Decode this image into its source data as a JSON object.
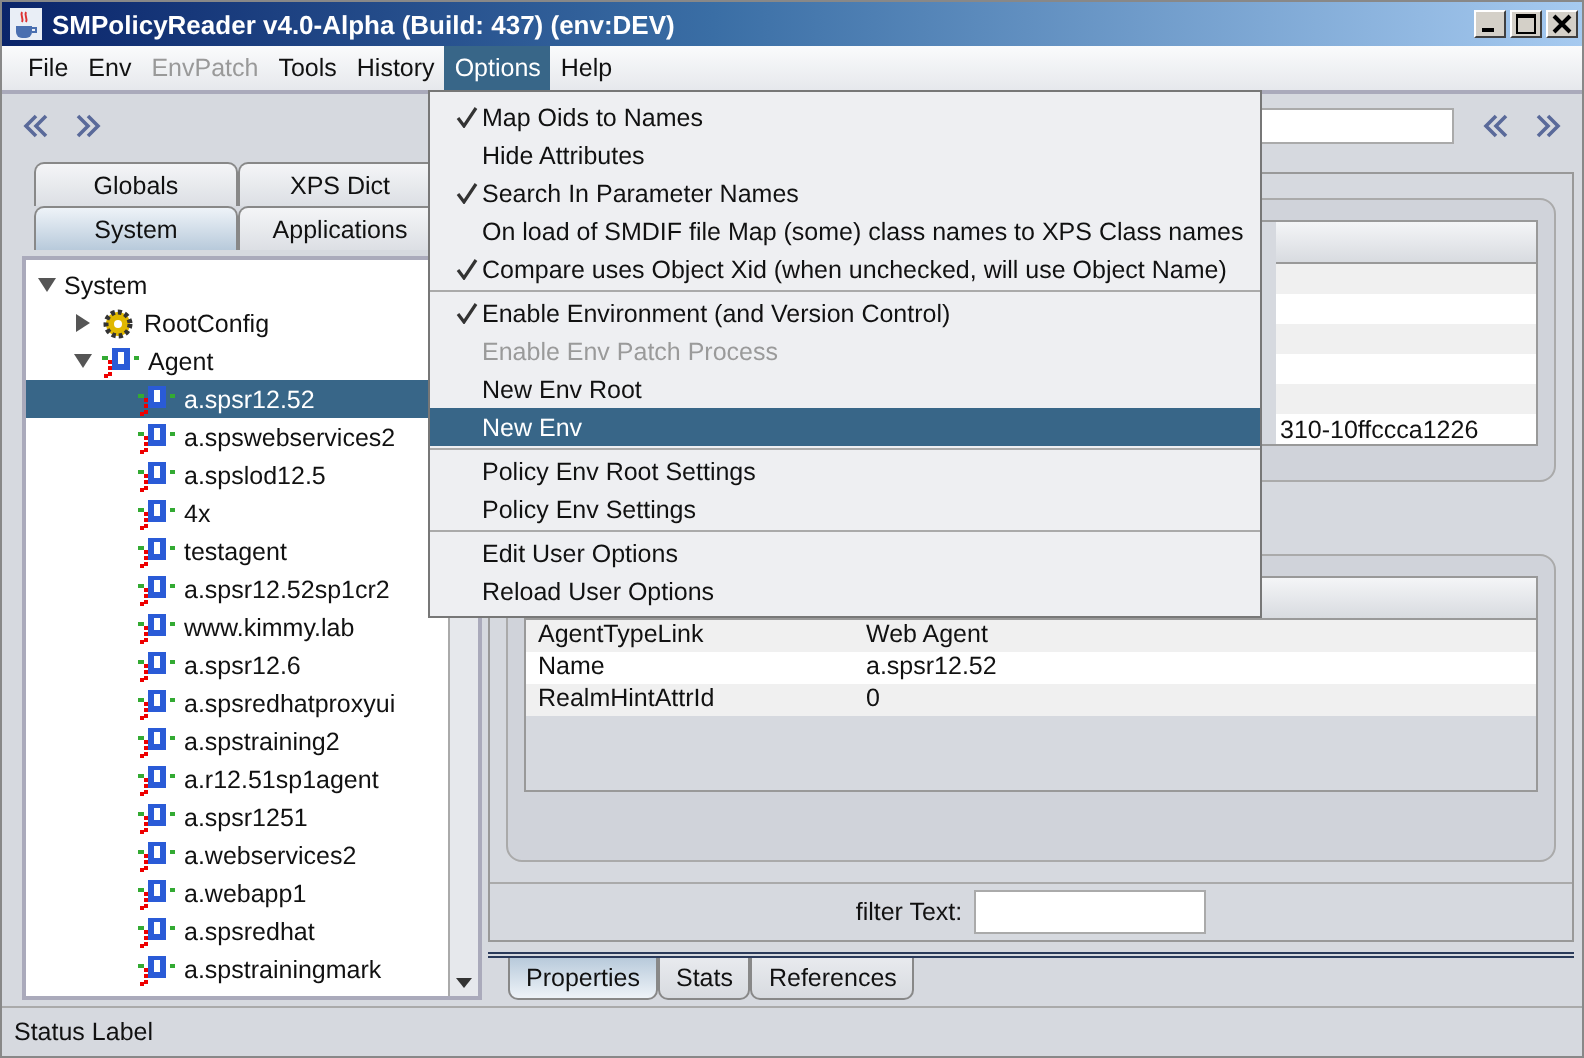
{
  "window": {
    "title": "SMPolicyReader v4.0-Alpha (Build: 437) (env:DEV)"
  },
  "menubar": [
    {
      "label": "File",
      "selected": false,
      "disabled": false
    },
    {
      "label": "Env",
      "selected": false,
      "disabled": false
    },
    {
      "label": "EnvPatch",
      "selected": false,
      "disabled": true
    },
    {
      "label": "Tools",
      "selected": false,
      "disabled": false
    },
    {
      "label": "History",
      "selected": false,
      "disabled": false
    },
    {
      "label": "Options",
      "selected": true,
      "disabled": false
    },
    {
      "label": "Help",
      "selected": false,
      "disabled": false
    }
  ],
  "options_menu": [
    {
      "kind": "item",
      "label": "Map Oids to Names",
      "checked": true,
      "disabled": false,
      "selected": false
    },
    {
      "kind": "item",
      "label": "Hide Attributes",
      "checked": false,
      "disabled": false,
      "selected": false
    },
    {
      "kind": "item",
      "label": "Search In Parameter Names",
      "checked": true,
      "disabled": false,
      "selected": false
    },
    {
      "kind": "item",
      "label": "On load of SMDIF file Map (some) class names to XPS Class names",
      "checked": false,
      "disabled": false,
      "selected": false
    },
    {
      "kind": "item",
      "label": "Compare uses Object Xid (when unchecked, will use Object Name)",
      "checked": true,
      "disabled": false,
      "selected": false
    },
    {
      "kind": "separator"
    },
    {
      "kind": "item",
      "label": "Enable Environment (and Version Control)",
      "checked": true,
      "disabled": false,
      "selected": false
    },
    {
      "kind": "item",
      "label": "Enable Env Patch Process",
      "checked": false,
      "disabled": true,
      "selected": false
    },
    {
      "kind": "item",
      "label": "New Env Root",
      "checked": false,
      "disabled": false,
      "selected": false
    },
    {
      "kind": "item",
      "label": "New Env",
      "checked": false,
      "disabled": false,
      "selected": true
    },
    {
      "kind": "separator"
    },
    {
      "kind": "item",
      "label": "Policy Env Root Settings",
      "checked": false,
      "disabled": false,
      "selected": false
    },
    {
      "kind": "item",
      "label": "Policy Env Settings",
      "checked": false,
      "disabled": false,
      "selected": false
    },
    {
      "kind": "separator"
    },
    {
      "kind": "item",
      "label": "Edit User Options",
      "checked": false,
      "disabled": false,
      "selected": false
    },
    {
      "kind": "item",
      "label": "Reload User Options",
      "checked": false,
      "disabled": false,
      "selected": false
    }
  ],
  "left_tabs": [
    [
      {
        "label": "Globals",
        "selected": false
      },
      {
        "label": "XPS Dict",
        "selected": false
      }
    ],
    [
      {
        "label": "System",
        "selected": true
      },
      {
        "label": "Applications",
        "selected": false
      }
    ]
  ],
  "tree": [
    {
      "label": "System",
      "expanded": true,
      "selected": false,
      "children": [
        {
          "label": "RootConfig",
          "kind": "config",
          "expanded": false,
          "selected": false
        },
        {
          "label": "Agent",
          "kind": "agent_group",
          "expanded": true,
          "selected": false,
          "children": [
            {
              "label": "a.spsr12.52",
              "kind": "agent",
              "selected": true
            },
            {
              "label": "a.spswebservices2",
              "kind": "agent",
              "selected": false
            },
            {
              "label": "a.spslod12.5",
              "kind": "agent",
              "selected": false
            },
            {
              "label": "4x",
              "kind": "agent",
              "selected": false
            },
            {
              "label": "testagent",
              "kind": "agent",
              "selected": false
            },
            {
              "label": "a.spsr12.52sp1cr2",
              "kind": "agent",
              "selected": false
            },
            {
              "label": "www.kimmy.lab",
              "kind": "agent",
              "selected": false
            },
            {
              "label": "a.spsr12.6",
              "kind": "agent",
              "selected": false
            },
            {
              "label": "a.spsredhatproxyui",
              "kind": "agent",
              "selected": false
            },
            {
              "label": "a.spstraining2",
              "kind": "agent",
              "selected": false
            },
            {
              "label": "a.r12.51sp1agent",
              "kind": "agent",
              "selected": false
            },
            {
              "label": "a.spsr1251",
              "kind": "agent",
              "selected": false
            },
            {
              "label": "a.webservices2",
              "kind": "agent",
              "selected": false
            },
            {
              "label": "a.webapp1",
              "kind": "agent",
              "selected": false
            },
            {
              "label": "a.spsredhat",
              "kind": "agent",
              "selected": false
            },
            {
              "label": "a.spstrainingmark",
              "kind": "agent",
              "selected": false
            }
          ]
        }
      ]
    }
  ],
  "upper_table": {
    "last_row_value": "310-10ffccca1226"
  },
  "properties_table": {
    "rows": [
      {
        "property": "AgentTypeLink",
        "value": "Web Agent"
      },
      {
        "property": "Name",
        "value": "a.spsr12.52"
      },
      {
        "property": "RealmHintAttrId",
        "value": "0"
      }
    ]
  },
  "filter": {
    "label": "filter Text:"
  },
  "bottom_tabs": [
    {
      "label": "Properties",
      "selected": true
    },
    {
      "label": "Stats",
      "selected": false
    },
    {
      "label": "References",
      "selected": false
    }
  ],
  "status_bar": "Status Label"
}
